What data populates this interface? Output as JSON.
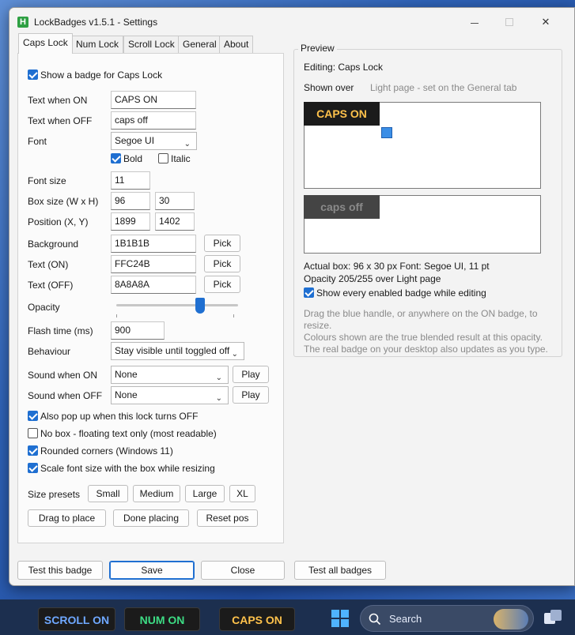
{
  "window": {
    "title": "LockBadges v1.5.1 - Settings",
    "icon_letter": "H",
    "minimize": "–",
    "close": "✕"
  },
  "tabs": [
    {
      "label": "Caps Lock",
      "active": true
    },
    {
      "label": "Num Lock"
    },
    {
      "label": "Scroll Lock"
    },
    {
      "label": "General"
    },
    {
      "label": "About"
    }
  ],
  "caps": {
    "show_badge_label": "Show a badge for Caps Lock",
    "text_on_label": "Text when ON",
    "text_on_value": "CAPS ON",
    "text_off_label": "Text when OFF",
    "text_off_value": "caps off",
    "font_label": "Font",
    "font_value": "Segoe UI",
    "bold_label": "Bold",
    "italic_label": "Italic",
    "font_size_label": "Font size",
    "font_size_value": "11",
    "box_size_label": "Box size (W x H)",
    "box_w": "96",
    "box_h": "30",
    "position_label": "Position (X, Y)",
    "pos_x": "1899",
    "pos_y": "1402",
    "background_label": "Background",
    "background_value": "1B1B1B",
    "text_on_color_label": "Text (ON)",
    "text_on_color_value": "FFC24B",
    "text_off_color_label": "Text (OFF)",
    "text_off_color_value": "8A8A8A",
    "pick_label": "Pick",
    "opacity_label": "Opacity",
    "opacity_value": 205,
    "flash_label": "Flash time (ms)",
    "flash_value": "900",
    "behaviour_label": "Behaviour",
    "behaviour_value": "Stay visible until toggled off",
    "sound_on_label": "Sound when ON",
    "sound_on_value": "None",
    "sound_off_label": "Sound when OFF",
    "sound_off_value": "None",
    "play_label": "Play",
    "popup_off_label": "Also pop up when this lock turns OFF",
    "no_box_label": "No box - floating text only (most readable)",
    "rounded_label": "Rounded corners (Windows 11)",
    "scale_font_label": "Scale font size with the box while resizing",
    "size_presets_label": "Size presets",
    "preset_small": "Small",
    "preset_medium": "Medium",
    "preset_large": "Large",
    "preset_xl": "XL",
    "drag_label": "Drag to place",
    "done_label": "Done placing",
    "reset_label": "Reset pos"
  },
  "preview": {
    "group_title": "Preview",
    "editing": "Editing: Caps Lock",
    "shown_over_label": "Shown over",
    "shown_over_value": "Light page  -  set on the General tab",
    "badge_on_text": "CAPS ON",
    "badge_off_text": "caps off",
    "actual_box": "Actual box: 96 x 30 px    Font: Segoe UI, 11 pt",
    "opacity_line": "Opacity 205/255 over Light page",
    "show_every_label": "Show every enabled badge while editing",
    "hint1": "Drag the blue handle, or anywhere on the ON badge, to",
    "hint2": "resize.",
    "hint3": "Colours shown are the true blended result at this opacity.",
    "hint4": "The real badge on your desktop also updates as you type."
  },
  "footer": {
    "test_badge": "Test this badge",
    "save": "Save",
    "close": "Close",
    "test_all": "Test all badges"
  },
  "taskbar": {
    "scroll_badge": "SCROLL ON",
    "num_badge": "NUM ON",
    "caps_badge": "CAPS ON",
    "search_placeholder": "Search"
  },
  "colors": {
    "badge_bg": "#1B1B1B",
    "caps_on_text": "#FFC24B",
    "caps_off_text": "#8A8A8A",
    "scroll_text": "#6FA8FF",
    "num_text": "#3DDC84",
    "accent": "#1F6FD1"
  }
}
